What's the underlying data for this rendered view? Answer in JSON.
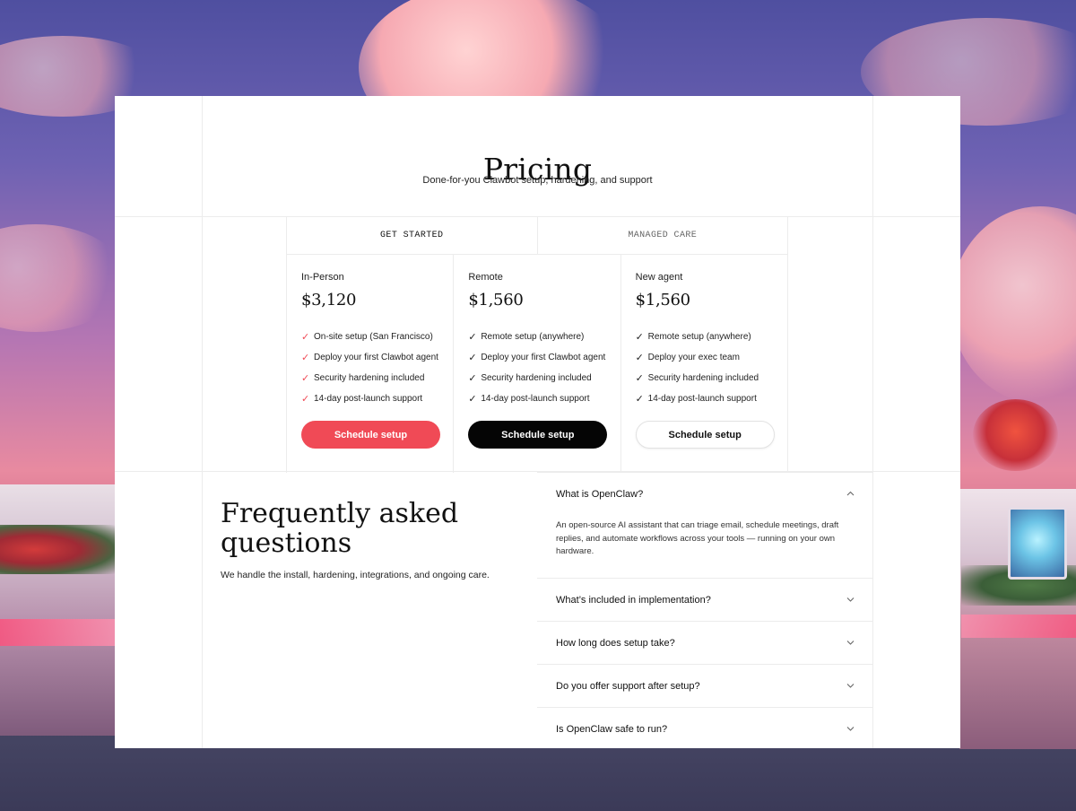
{
  "hero": {
    "title": "Pricing",
    "subtitle": "Done-for-you Clawbot setup, hardening, and support"
  },
  "tabs": [
    {
      "label": "GET STARTED",
      "active": true
    },
    {
      "label": "MANAGED CARE",
      "active": false
    }
  ],
  "plans": [
    {
      "name": "In-Person",
      "price": "$3,120",
      "check_color": "#f04a56",
      "features": [
        "On-site setup (San Francisco)",
        "Deploy your first Clawbot agent",
        "Security hardening included",
        "14-day post-launch support"
      ],
      "button_label": "Schedule setup",
      "button_color": "#f04a56"
    },
    {
      "name": "Remote",
      "price": "$1,560",
      "check_color": "#111111",
      "features": [
        "Remote setup (anywhere)",
        "Deploy your first Clawbot agent",
        "Security hardening included",
        "14-day post-launch support"
      ],
      "button_label": "Schedule setup",
      "button_color": "#050505"
    },
    {
      "name": "New agent",
      "price": "$1,560",
      "check_color": "#111111",
      "features": [
        "Remote setup (anywhere)",
        "Deploy your exec team",
        "Security hardening included",
        "14-day post-launch support"
      ],
      "button_label": "Schedule setup",
      "button_color": "#ffffff"
    }
  ],
  "faq": {
    "title_line1": "Frequently asked",
    "title_line2": "questions",
    "subtitle": "We handle the install, hardening, integrations, and ongoing care.",
    "items": [
      {
        "question": "What is OpenClaw?",
        "answer": "An open-source AI assistant that can triage email, schedule meetings, draft replies, and automate workflows across your tools — running on your own hardware.",
        "open": true,
        "icon": "chevron-up-icon"
      },
      {
        "question": "What’s included in implementation?",
        "open": false,
        "icon": "chevron-down-icon"
      },
      {
        "question": "How long does setup take?",
        "open": false,
        "icon": "chevron-down-icon"
      },
      {
        "question": "Do you offer support after setup?",
        "open": false,
        "icon": "chevron-down-icon"
      },
      {
        "question": "Is OpenClaw safe to run?",
        "open": false,
        "icon": "chevron-down-icon"
      }
    ]
  },
  "check_glyph": "✓"
}
